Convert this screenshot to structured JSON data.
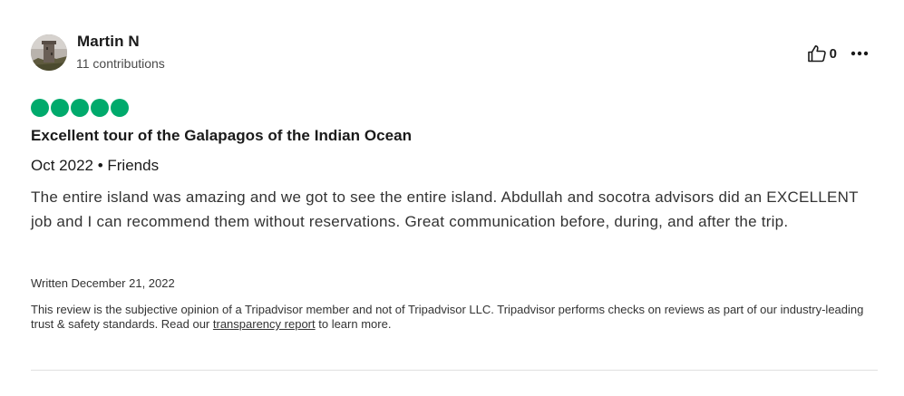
{
  "review": {
    "author": {
      "name": "Martin N",
      "contributions": "11 contributions",
      "avatar_icon": "user-avatar-photo"
    },
    "helpful": {
      "icon": "thumbs-up-icon",
      "count": "0"
    },
    "more_icon": "ellipsis-icon",
    "rating": {
      "value": 5,
      "max": 5,
      "color": "#00aa6c"
    },
    "title": "Excellent tour of the Galapagos of the Indian Ocean",
    "trip_meta": "Oct 2022 • Friends",
    "text": "The entire island was amazing and we got to see the entire island. Abdullah and socotra advisors did an EXCELLENT job and I can recommend them without reservations. Great communication before, during, and after the trip.",
    "written": "Written December 21, 2022",
    "disclaimer": {
      "before": "This review is the subjective opinion of a Tripadvisor member and not of Tripadvisor LLC. Tripadvisor performs checks on reviews as part of our industry-leading trust & safety standards. Read our ",
      "link": "transparency report",
      "after": " to learn more."
    }
  }
}
